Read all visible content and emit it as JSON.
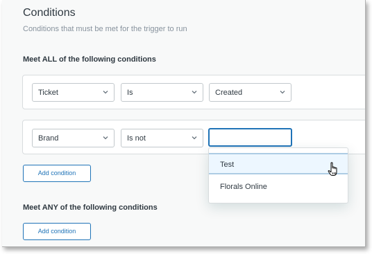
{
  "header": {
    "title": "Conditions",
    "subtitle": "Conditions that must be met for the trigger to run"
  },
  "all_section": {
    "label": "Meet ALL of the following conditions",
    "rows": [
      {
        "field": "Ticket",
        "operator": "Is",
        "value": "Created"
      },
      {
        "field": "Brand",
        "operator": "Is not",
        "value": ""
      }
    ],
    "add_button": "Add condition"
  },
  "dropdown": {
    "options": [
      "Test",
      "Florals Online"
    ],
    "hovered": "Test"
  },
  "any_section": {
    "label": "Meet ANY of the following conditions",
    "add_button": "Add condition"
  },
  "icons": {
    "chevron": "chevron-down-icon",
    "cursor": "hand-pointer-icon"
  },
  "colors": {
    "accent": "#1f73b7",
    "text": "#2f3941",
    "muted": "#87929d",
    "border": "#d8dcde"
  }
}
